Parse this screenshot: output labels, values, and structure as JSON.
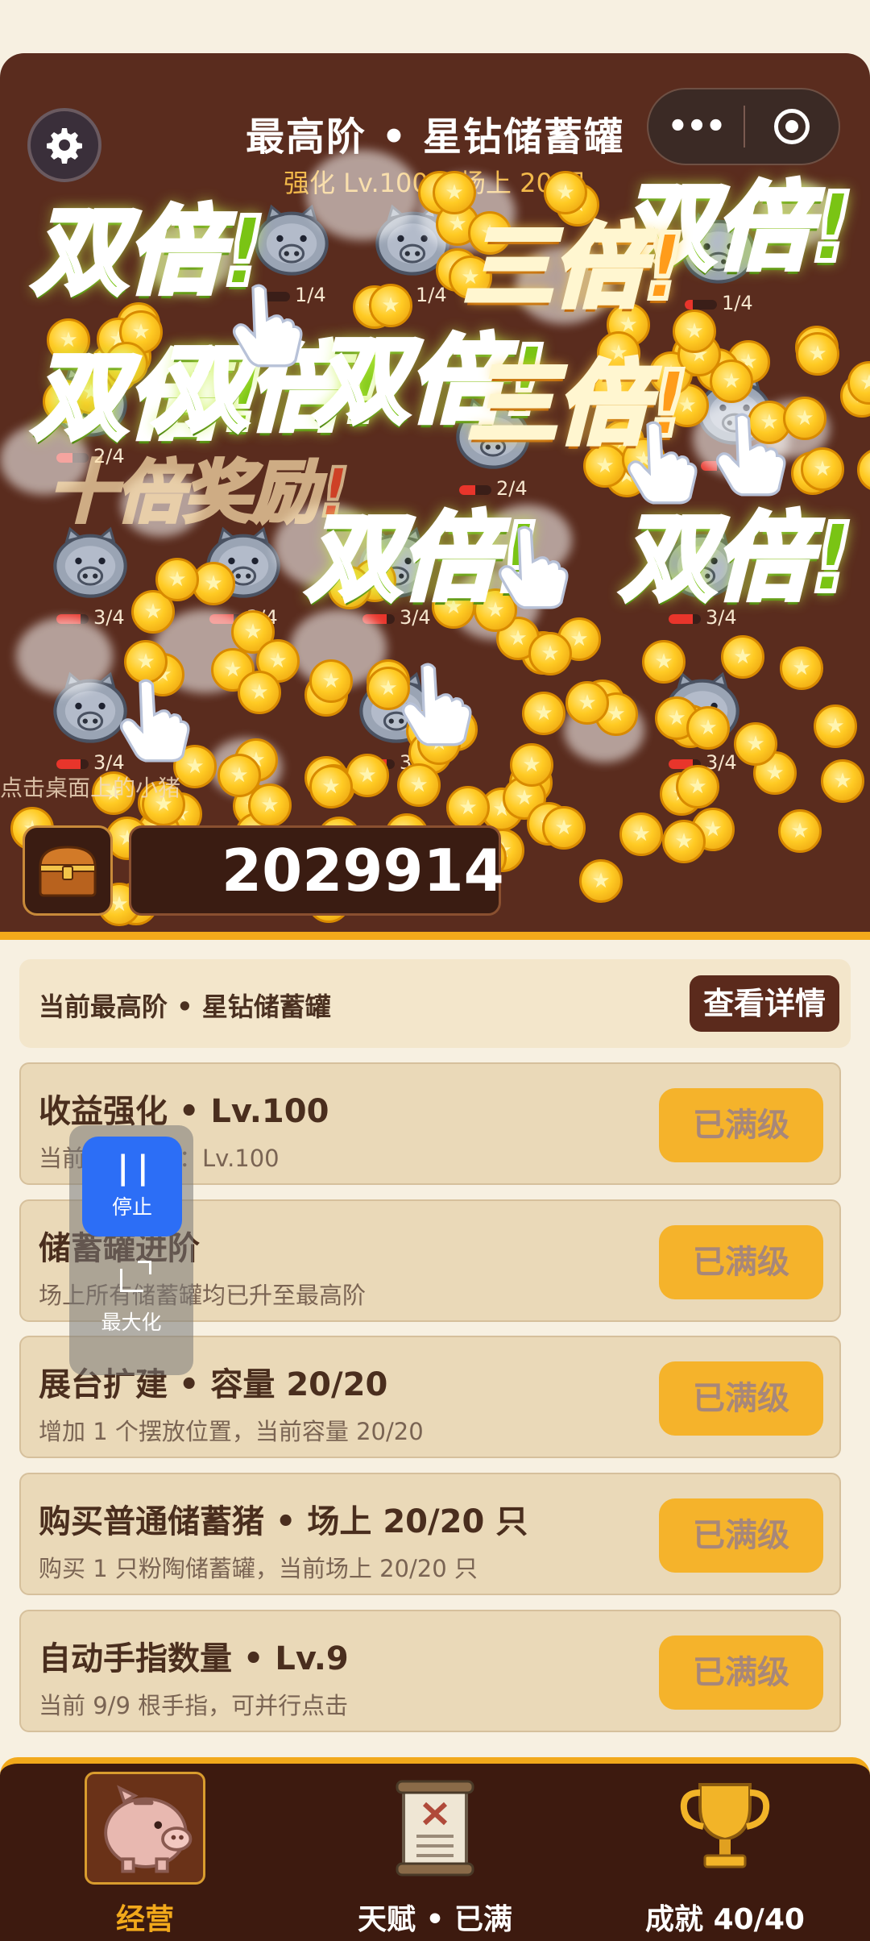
{
  "header": {
    "title": "最高阶 • 星钻储蓄罐",
    "subtitle": "强化 Lv.100 • 场上 20 只"
  },
  "capsule": {
    "more_label": "•••"
  },
  "game": {
    "banners": {
      "double": "双倍!",
      "triple": "三倍!",
      "ten": "十倍奖励!"
    },
    "pig_labels": [
      "1/4",
      "1/4",
      "1/4",
      "2/4",
      "2/4",
      "2/4",
      "3/4",
      "3/4",
      "3/4",
      "3/4",
      "3/4",
      "3/4",
      "3/4"
    ],
    "tap_tip": "点击桌面上的小猪",
    "score": "2029914"
  },
  "info": {
    "label": "当前最高阶 • 星钻储蓄罐",
    "button": "查看详情"
  },
  "upgrades": [
    {
      "title": "收益强化 • Lv.100",
      "desc": "当前收益等级：Lv.100",
      "action": "已满级"
    },
    {
      "title": "储蓄罐进阶",
      "desc": "场上所有储蓄罐均已升至最高阶",
      "action": "已满级"
    },
    {
      "title": "展台扩建 • 容量 20/20",
      "desc": "增加 1 个摆放位置，当前容量 20/20",
      "action": "已满级"
    },
    {
      "title": "购买普通储蓄猪 • 场上 20/20 只",
      "desc": "购买 1 只粉陶储蓄罐，当前场上 20/20 只",
      "action": "已满级"
    },
    {
      "title": "自动手指数量 • Lv.9",
      "desc": "当前 9/9 根手指，可并行点击",
      "action": "已满级"
    }
  ],
  "floater": {
    "stop": "停止",
    "maximize": "最大化"
  },
  "nav": [
    {
      "label": "经营",
      "icon": "piggy-bank-icon",
      "active": true
    },
    {
      "label": "天赋 • 已满",
      "icon": "scroll-icon",
      "active": false
    },
    {
      "label": "成就 40/40",
      "icon": "trophy-icon",
      "active": false
    }
  ],
  "colors": {
    "game_bg": "#5a2c1e",
    "accent": "#f2a91b",
    "card_bg": "#ead9b8",
    "button_bg": "#f5b32b",
    "double_green": "#7ac414",
    "triple_orange": "#ff9c1a"
  }
}
